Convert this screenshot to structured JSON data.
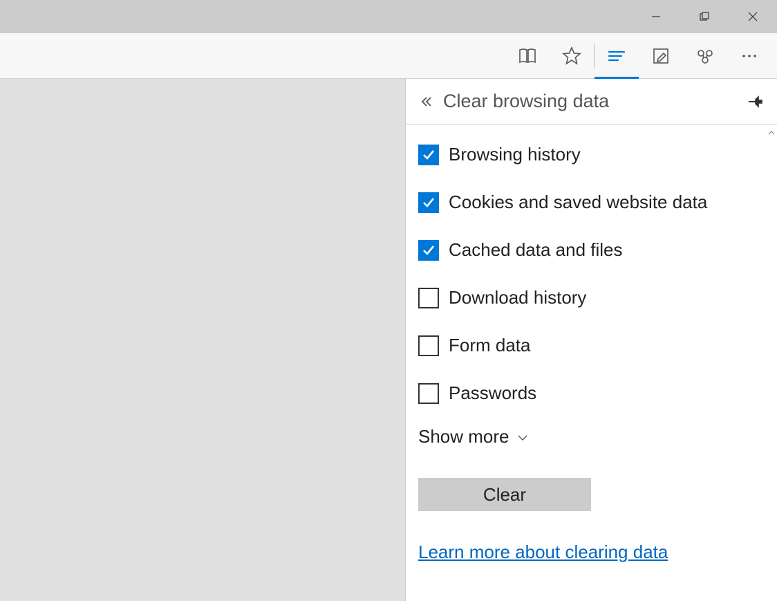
{
  "panel": {
    "title": "Clear browsing data",
    "show_more": "Show more",
    "clear_button": "Clear",
    "learn_link": "Learn more about clearing data",
    "items": [
      {
        "label": "Browsing history",
        "checked": true
      },
      {
        "label": "Cookies and saved website data",
        "checked": true
      },
      {
        "label": "Cached data and files",
        "checked": true
      },
      {
        "label": "Download history",
        "checked": false
      },
      {
        "label": "Form data",
        "checked": false
      },
      {
        "label": "Passwords",
        "checked": false
      }
    ]
  }
}
